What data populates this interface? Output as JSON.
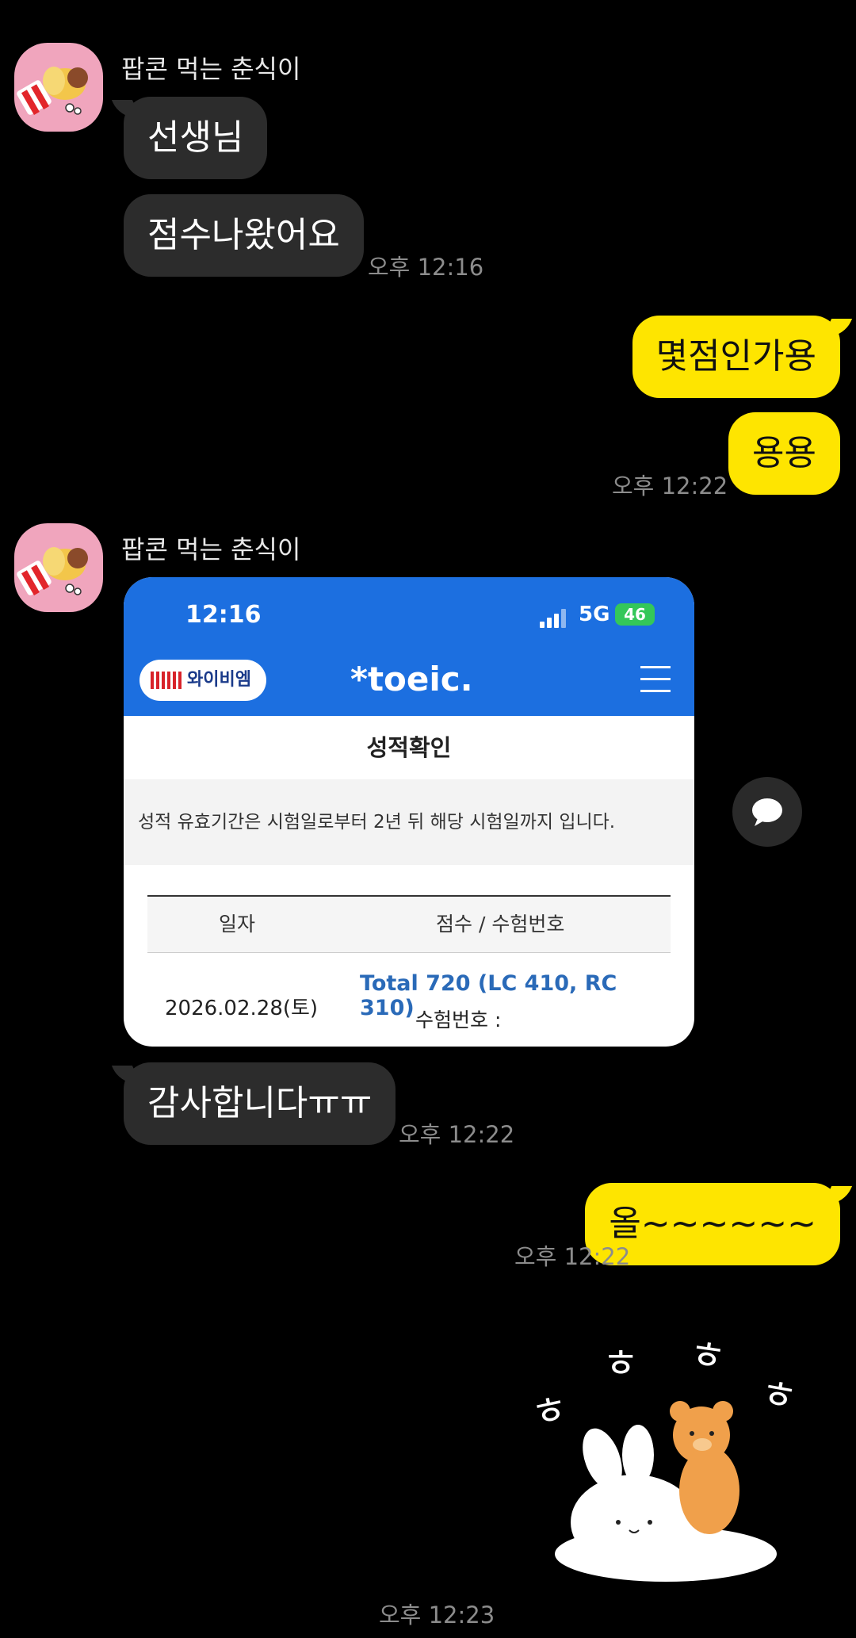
{
  "messages": {
    "sender_name": "팝콘 먹는 춘식이",
    "m1": "선생님",
    "m2": "점수나왔어요",
    "t1": "오후 12:16",
    "o1": "몇점인가용",
    "o2": "용용",
    "t2": "오후 12:22",
    "m3": "감사합니다ㅠㅠ",
    "t3": "오후 12:22",
    "o3": "올~~~~~~",
    "t4": "오후 12:22",
    "t5": "오후 12:23"
  },
  "screenshot": {
    "clock": "12:16",
    "network": "5G",
    "battery": "46",
    "ybm_label": "와이비엠",
    "logo": "*toeic.",
    "page_title": "성적확인",
    "notice": "성적 유효기간은 시험일로부터 2년 뒤 해당 시험일까지 입니다.",
    "col_date": "일자",
    "col_score": "점수 / 수험번호",
    "date": "2026.02.28(토)",
    "score": "Total 720 (LC 410, RC 310)",
    "reg_label": "수험번호 :"
  },
  "sticker": {
    "text_1": "ㅎ",
    "text_2": "ㅎ",
    "text_3": "ㅎ",
    "text_4": "ㅎ"
  },
  "icons": {
    "avatar": "chunsik-popcorn-avatar",
    "share": "speech-bubble-icon"
  },
  "colors": {
    "background": "#000000",
    "incoming_bubble": "#2c2c2c",
    "outgoing_bubble": "#fee500",
    "toeic_blue": "#1c6fe0",
    "score_blue": "#2a6ab8"
  }
}
